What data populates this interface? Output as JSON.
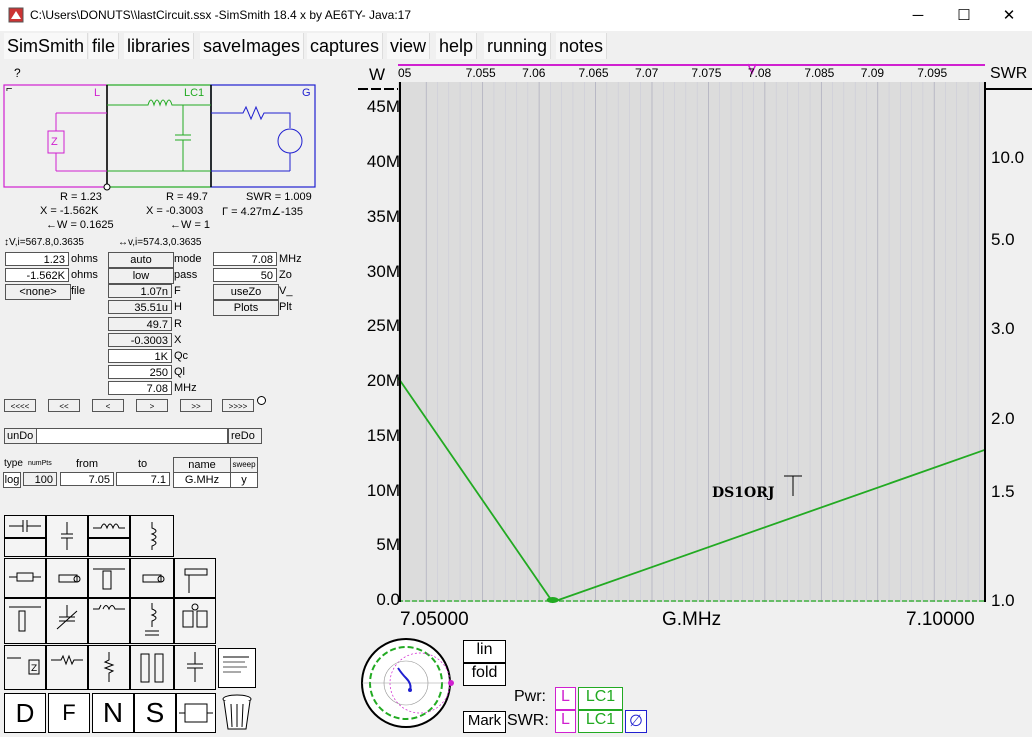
{
  "window": {
    "title": "C:\\Users\\DONUTS\\\\lastCircuit.ssx  -SimSmith 18.4 x by AE6TY-   Java:17",
    "minimize": "─",
    "maximize": "☐",
    "close": "✕"
  },
  "menu": [
    "SimSmith",
    "file",
    "libraries",
    "saveImages",
    "captures",
    "view",
    "help",
    "running",
    "notes"
  ],
  "help_mark": "?",
  "schematic": {
    "load_label": "L",
    "lc_label": "LC1",
    "gen_label": "G",
    "load_symbol": "Z",
    "corner_mark": "⌐",
    "col1": [
      "R = 1.23",
      "X = -1.562K",
      "←W = 0.1625"
    ],
    "col2": [
      "R = 49.7",
      "X = -0.3003",
      "←W = 1"
    ],
    "col3": [
      "SWR = 1.009",
      "Γ = 4.27m∠-135"
    ],
    "vi1": "↕V,i=567.8,0.3635",
    "vi2": "↔v,i=574.3,0.3635"
  },
  "load_params": [
    {
      "value": "1.23",
      "unit": "ohms"
    },
    {
      "value": "-1.562K",
      "unit": "ohms"
    },
    {
      "value": "<none>",
      "unit": "file"
    }
  ],
  "lc_params": [
    {
      "value": "auto",
      "unit": "mode"
    },
    {
      "value": "low",
      "unit": "pass"
    },
    {
      "value": "1.07n",
      "unit": "F"
    },
    {
      "value": "35.51u",
      "unit": "H"
    },
    {
      "value": "49.7",
      "unit": "R"
    },
    {
      "value": "-0.3003",
      "unit": "X"
    },
    {
      "value": "1K",
      "unit": "Qc"
    },
    {
      "value": "250",
      "unit": "Ql"
    },
    {
      "value": "7.08",
      "unit": "MHz"
    }
  ],
  "gen_params": [
    {
      "value": "7.08",
      "unit": "MHz"
    },
    {
      "value": "50",
      "unit": "Zo"
    },
    {
      "value": "useZo",
      "unit": "V_"
    },
    {
      "value": "Plots",
      "unit": "Plt"
    }
  ],
  "nav_buttons": [
    "<<<<",
    "<<",
    "<",
    ">",
    ">>",
    ">>>>"
  ],
  "undo": "unDo",
  "redo": "reDo",
  "sweep": {
    "headers": [
      "type",
      "numPts",
      "from",
      "to",
      "name",
      "sweep"
    ],
    "values": [
      "log",
      "100",
      "7.05",
      "7.1",
      "G.MHz",
      "y"
    ]
  },
  "chart_data": {
    "type": "line",
    "series": [
      {
        "x": [
          7.0475,
          7.0612,
          7.0995
        ],
        "y": [
          20.5,
          0,
          13.9
        ]
      }
    ],
    "x_ticks": [
      "05",
      "7.055",
      "7.06",
      "7.065",
      "7.07",
      "7.075",
      "7.08",
      "7.085",
      "7.09",
      "7.095"
    ],
    "x_tick_values": [
      7.05,
      7.055,
      7.06,
      7.065,
      7.07,
      7.075,
      7.08,
      7.085,
      7.09,
      7.095
    ],
    "y_ticks": [
      "45M",
      "40M",
      "35M",
      "30M",
      "25M",
      "20M",
      "15M",
      "10M",
      "5M",
      "0.0"
    ],
    "swr_ticks": [
      "10.0",
      "5.0",
      "3.0",
      "2.0",
      "1.5",
      "1.0"
    ],
    "left_axis_label": "W",
    "right_axis_label": "SWR",
    "x_left": "7.05000",
    "x_center": "G.MHz",
    "x_right": "7.10000",
    "xlim": [
      7.0475,
      7.0995
    ],
    "ylim": [
      0,
      47.5
    ],
    "grid": true,
    "line_color": "#22aa22"
  },
  "watermark": "DS1ORJ",
  "controls": {
    "lin": "lin",
    "fold": "fold",
    "mark": "Mark",
    "pwr_label": "Pwr:",
    "swr_label": "SWR:",
    "pwr_items": [
      "L",
      "LC1"
    ],
    "swr_items": [
      "L",
      "LC1"
    ],
    "no_symbol": "∅"
  },
  "palette_names": [
    "series-c",
    "shunt-c",
    "series-l",
    "shunt-l"
  ],
  "big_tools": [
    "D",
    "F",
    "N",
    "S"
  ]
}
